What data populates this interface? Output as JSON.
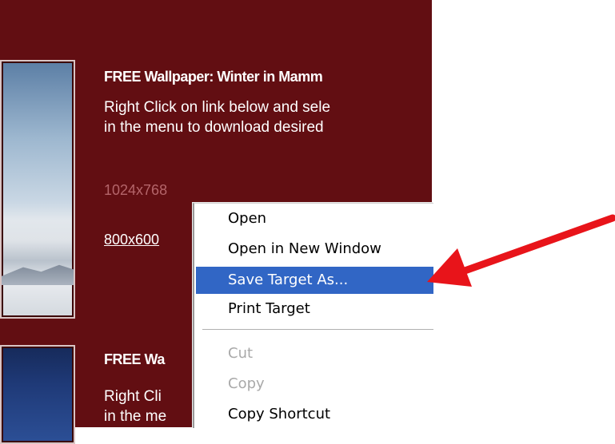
{
  "wallpaper1": {
    "title": "FREE Wallpaper: Winter in Mamm",
    "desc_line1": "Right Click on link below and sele",
    "desc_line2": "in the menu to download desired",
    "link_1024": "1024x768",
    "link_800": "800x600"
  },
  "wallpaper2": {
    "title": "FREE Wa",
    "desc_line1": "Right Cli",
    "desc_line2": "in the me"
  },
  "context_menu": {
    "items": [
      {
        "label": "Open",
        "state": "normal"
      },
      {
        "label": "Open in New Window",
        "state": "normal"
      },
      {
        "label": "Save Target As...",
        "state": "selected"
      },
      {
        "label": "Print Target",
        "state": "normal"
      },
      {
        "label": "Cut",
        "state": "disabled"
      },
      {
        "label": "Copy",
        "state": "disabled"
      },
      {
        "label": "Copy Shortcut",
        "state": "normal"
      }
    ]
  },
  "colors": {
    "page_bg": "#620e12",
    "visited_link": "#b4656a",
    "menu_highlight": "#3166c5",
    "arrow": "#e8141a"
  },
  "annotation": {
    "icon": "red-arrow-icon"
  }
}
